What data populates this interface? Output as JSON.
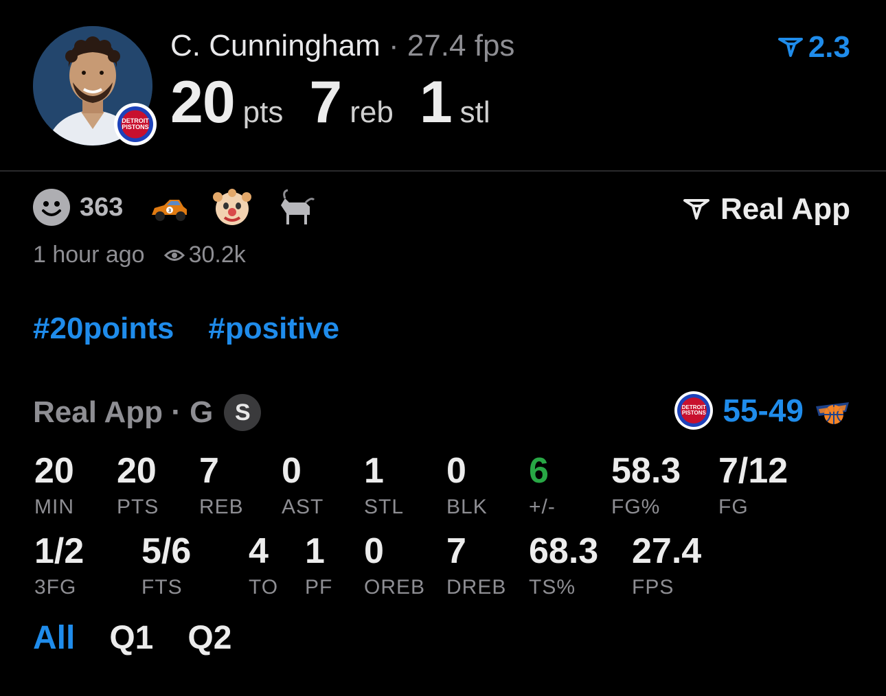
{
  "player": {
    "name": "C. Cunningham",
    "separator": "·",
    "fps_summary": "27.4 fps",
    "team_logo_text": [
      "DETROIT",
      "PISTONS"
    ]
  },
  "headline_stats": [
    {
      "value": "20",
      "unit": "pts"
    },
    {
      "value": "7",
      "unit": "reb"
    },
    {
      "value": "1",
      "unit": "stl"
    }
  ],
  "rating": {
    "value": "2.3",
    "icon": "real-app-logo-icon",
    "color": "#1f8ceb"
  },
  "reactions": {
    "count": "363",
    "emojis": [
      "race-car-icon",
      "clown-face-icon",
      "goat-icon"
    ]
  },
  "source": {
    "label": "Real App"
  },
  "meta": {
    "time": "1 hour ago",
    "views": "30.2k"
  },
  "hashtags": [
    "#20points",
    "#positive"
  ],
  "game": {
    "label": "Real App · G",
    "badge": "S",
    "score": "55-49"
  },
  "stats_row1": [
    {
      "value": "20",
      "label": "MIN"
    },
    {
      "value": "20",
      "label": "PTS"
    },
    {
      "value": "7",
      "label": "REB"
    },
    {
      "value": "0",
      "label": "AST"
    },
    {
      "value": "1",
      "label": "STL"
    },
    {
      "value": "0",
      "label": "BLK"
    },
    {
      "value": "6",
      "label": "+/-",
      "color": "#28a745"
    },
    {
      "value": "58.3",
      "label": "FG%"
    },
    {
      "value": "7/12",
      "label": "FG"
    }
  ],
  "stats_row2": [
    {
      "value": "1/2",
      "label": "3FG"
    },
    {
      "value": "5/6",
      "label": "FTS"
    },
    {
      "value": "4",
      "label": "TO"
    },
    {
      "value": "1",
      "label": "PF"
    },
    {
      "value": "0",
      "label": "OREB"
    },
    {
      "value": "7",
      "label": "DREB"
    },
    {
      "value": "68.3",
      "label": "TS%"
    },
    {
      "value": "27.4",
      "label": "FPS"
    }
  ],
  "tabs": [
    {
      "label": "All",
      "active": true
    },
    {
      "label": "Q1",
      "active": false
    },
    {
      "label": "Q2",
      "active": false
    }
  ],
  "colors": {
    "accent": "#1f8ceb",
    "positive": "#28a745",
    "muted": "#8e8e93"
  }
}
